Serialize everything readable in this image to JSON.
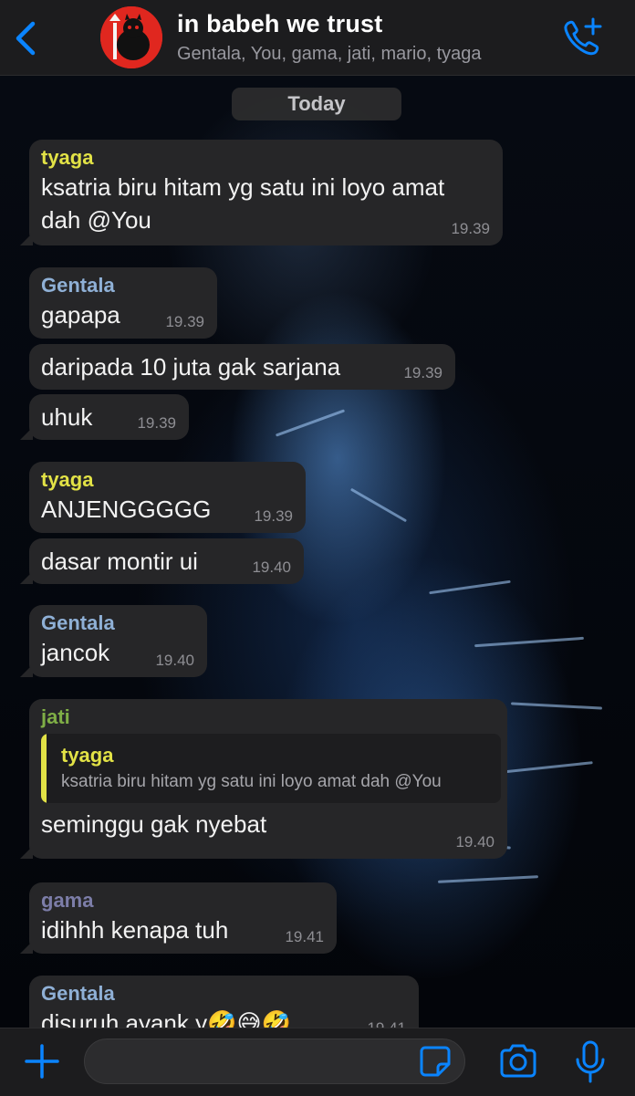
{
  "header": {
    "title": "in babeh we trust",
    "members": "Gentala, You, gama, jati, mario, tyaga"
  },
  "chat": {
    "date_divider": "Today",
    "messages": [
      {
        "sender": "tyaga",
        "text_line1": "ksatria biru hitam yg satu ini loyo amat",
        "text_line2": "dah @You",
        "time": "19.39"
      },
      {
        "sender": "Gentala",
        "text": "gapapa",
        "time": "19.39"
      },
      {
        "text": "daripada 10 juta gak sarjana",
        "time": "19.39"
      },
      {
        "text": "uhuk",
        "time": "19.39"
      },
      {
        "sender": "tyaga",
        "text": "ANJENGGGGG",
        "time": "19.39"
      },
      {
        "text": "dasar montir ui",
        "time": "19.40"
      },
      {
        "sender": "Gentala",
        "text": "jancok",
        "time": "19.40"
      },
      {
        "sender": "jati",
        "quote_sender": "tyaga",
        "quote_text": "ksatria biru hitam yg satu ini loyo amat dah @You",
        "text": "seminggu gak nyebat",
        "time": "19.40"
      },
      {
        "sender": "gama",
        "text": "idihhh kenapa tuh",
        "time": "19.41"
      },
      {
        "sender": "Gentala",
        "text": "disuruh ayank y🤣😅🤣",
        "time": "19.41"
      }
    ]
  },
  "colors": {
    "tyaga": "#e2e246",
    "Gentala": "#8fb0d6",
    "jati": "#7fae46",
    "gama": "#7c7da8",
    "accent": "#0a84ff"
  },
  "inputbar": {
    "placeholder": ""
  }
}
